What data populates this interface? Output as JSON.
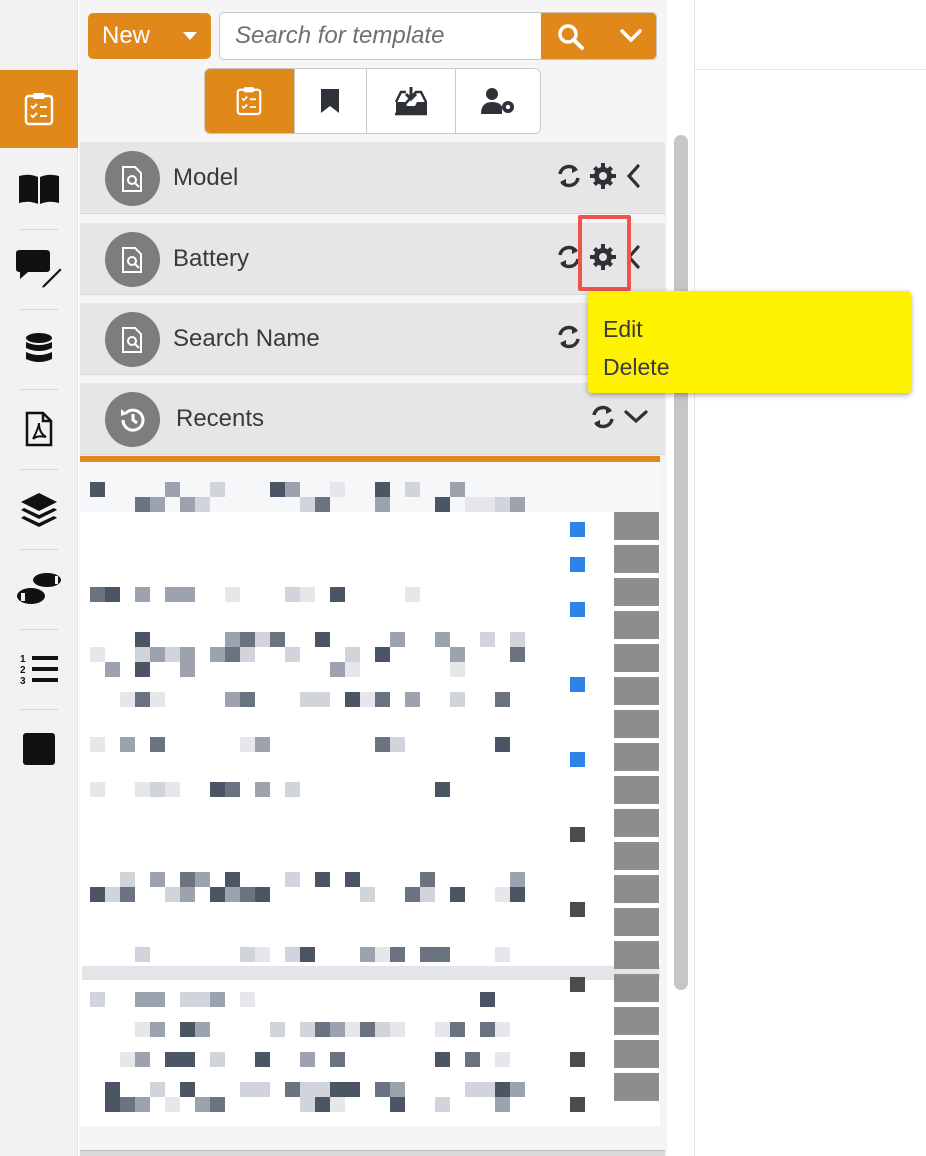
{
  "toolbar": {
    "new_label": "New",
    "search_placeholder": "Search for template"
  },
  "tabs": [
    {
      "name": "templates",
      "icon": "clipboard-check-icon",
      "active": true
    },
    {
      "name": "bookmarks",
      "icon": "bookmark-icon",
      "active": false
    },
    {
      "name": "import",
      "icon": "inbox-download-icon",
      "active": false
    },
    {
      "name": "user-settings",
      "icon": "user-gear-icon",
      "active": false
    }
  ],
  "sidebar": {
    "items": [
      {
        "icon": "clipboard-check-icon",
        "active": true
      },
      {
        "icon": "book-open-icon"
      },
      {
        "icon": "comments-edit-icon"
      },
      {
        "icon": "database-icon"
      },
      {
        "icon": "pdf-file-icon"
      },
      {
        "icon": "layers-icon"
      },
      {
        "icon": "footprints-icon"
      },
      {
        "icon": "numbered-list-icon"
      },
      {
        "icon": "stop-square-icon"
      }
    ]
  },
  "groups": [
    {
      "label": "Model"
    },
    {
      "label": "Battery"
    },
    {
      "label": "Search Name"
    },
    {
      "label": "Recents"
    }
  ],
  "context_menu": {
    "items": [
      "Edit",
      "Delete"
    ]
  },
  "colors": {
    "accent": "#e0881a",
    "menu_bg": "#fff200",
    "highlight": "#ef5350"
  }
}
